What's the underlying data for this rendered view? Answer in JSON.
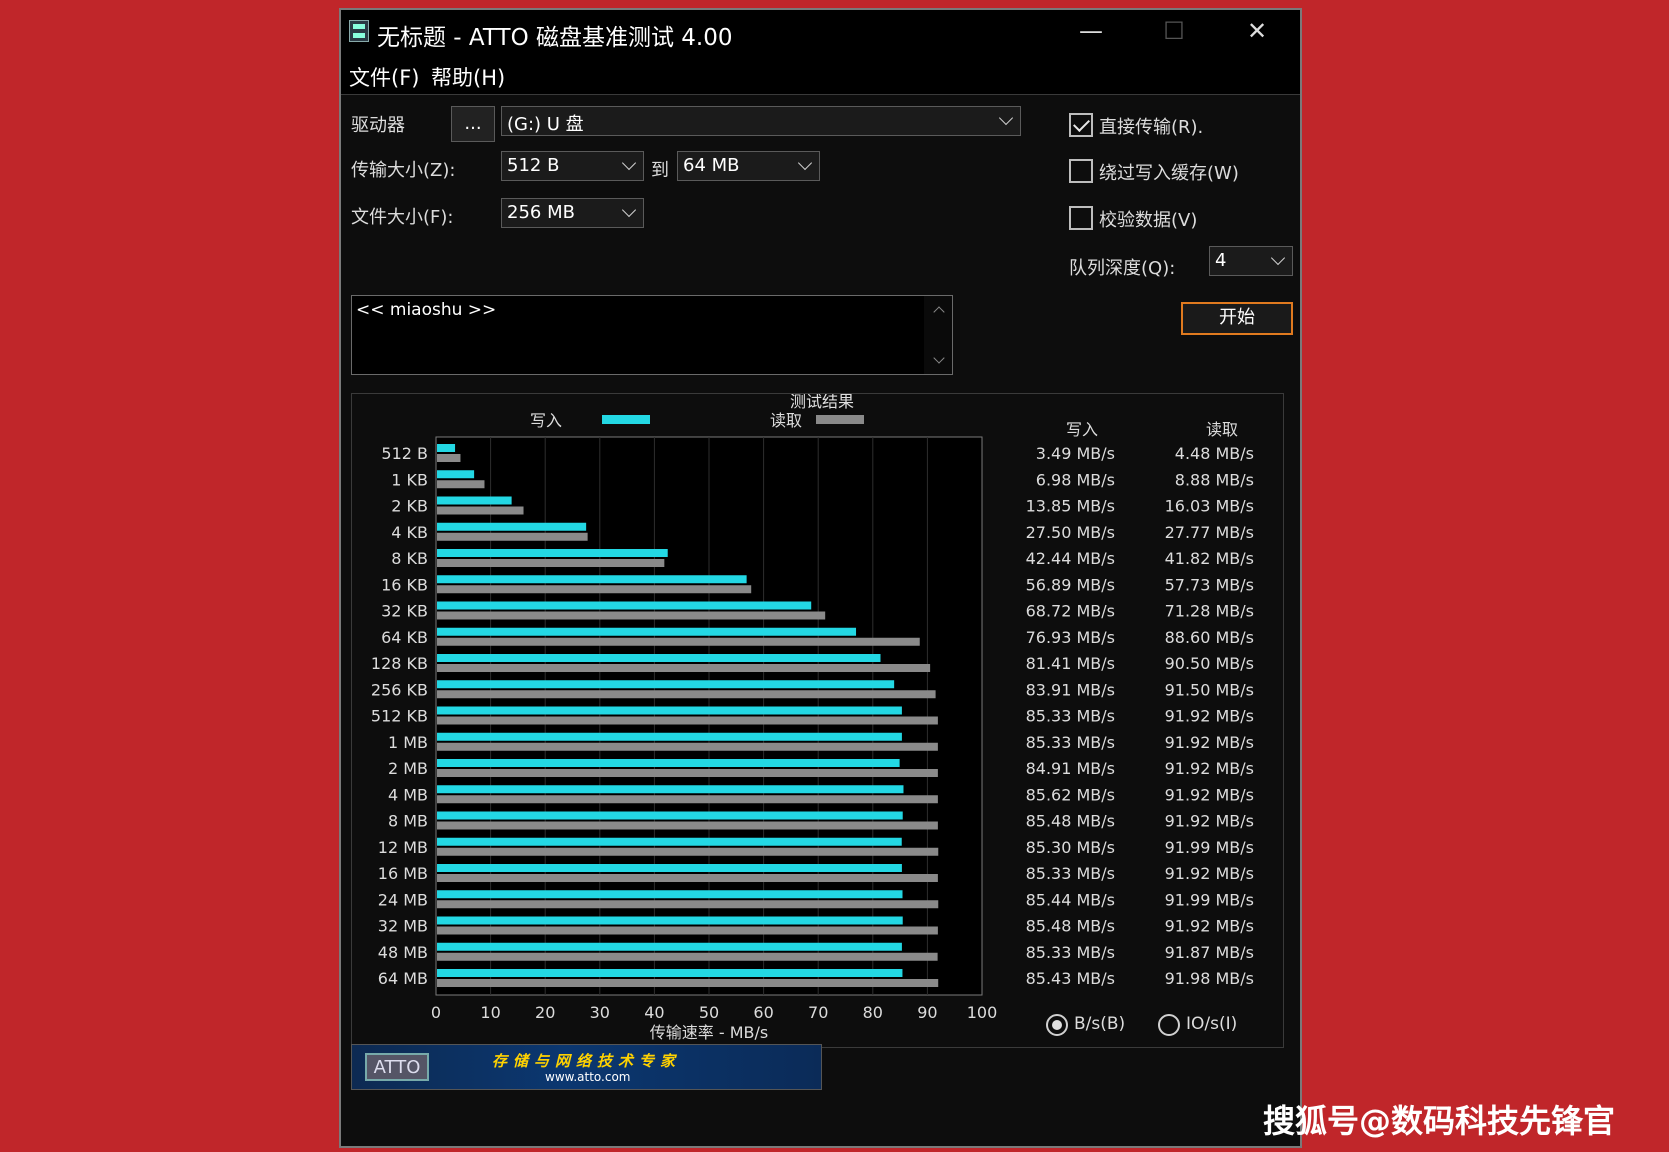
{
  "window": {
    "title": "无标题 - ATTO 磁盘基准测试 4.00",
    "minimize": "—",
    "maximize": "☐",
    "close": "✕"
  },
  "menu": {
    "file": "文件(F)",
    "help": "帮助(H)"
  },
  "settings": {
    "drive_label": "驱动器",
    "browse_button": "...",
    "drive_value": "(G:) U 盘",
    "transfer_label": "传输大小(Z):",
    "transfer_from": "512 B",
    "to_label": "到",
    "transfer_to": "64 MB",
    "file_size_label": "文件大小(F):",
    "file_size": "256 MB",
    "direct_io_label": "直接传输(R).",
    "direct_io_checked": true,
    "bypass_cache_label": "绕过写入缓存(W)",
    "bypass_cache_checked": false,
    "verify_label": "校验数据(V)",
    "verify_checked": false,
    "queue_label": "队列深度(Q):",
    "queue_depth": "4",
    "description": "<< miaoshu >>",
    "start_button": "开始"
  },
  "results": {
    "title": "测试结果",
    "legend_write": "写入",
    "legend_read": "读取",
    "col_write": "写入",
    "col_read": "读取",
    "radio_bps": "B/s(B)",
    "radio_iops": "IO/s(I)",
    "radio_selected": "B/s(B)"
  },
  "chart_data": {
    "type": "bar",
    "orientation": "horizontal",
    "xlabel": "传输速率 - MB/s",
    "xlim": [
      0,
      100
    ],
    "xticks": [
      "0",
      "10",
      "20",
      "30",
      "40",
      "50",
      "60",
      "70",
      "80",
      "90",
      "100"
    ],
    "grid": true,
    "legend": "top",
    "colors": {
      "write": "#23d8e4",
      "read": "#8a8a8a"
    },
    "categories": [
      "512 B",
      "1 KB",
      "2 KB",
      "4 KB",
      "8 KB",
      "16 KB",
      "32 KB",
      "64 KB",
      "128 KB",
      "256 KB",
      "512 KB",
      "1 MB",
      "2 MB",
      "4 MB",
      "8 MB",
      "12 MB",
      "16 MB",
      "24 MB",
      "32 MB",
      "48 MB",
      "64 MB"
    ],
    "series": [
      {
        "name": "写入",
        "values": [
          3.49,
          6.98,
          13.85,
          27.5,
          42.44,
          56.89,
          68.72,
          76.93,
          81.41,
          83.91,
          85.33,
          85.33,
          84.91,
          85.62,
          85.48,
          85.3,
          85.33,
          85.44,
          85.48,
          85.33,
          85.43
        ]
      },
      {
        "name": "读取",
        "values": [
          4.48,
          8.88,
          16.03,
          27.77,
          41.82,
          57.73,
          71.28,
          88.6,
          90.5,
          91.5,
          91.92,
          91.92,
          91.92,
          91.92,
          91.92,
          91.99,
          91.92,
          91.99,
          91.92,
          91.87,
          91.98
        ]
      }
    ],
    "write_labels": [
      "3.49 MB/s",
      "6.98 MB/s",
      "13.85 MB/s",
      "27.50 MB/s",
      "42.44 MB/s",
      "56.89 MB/s",
      "68.72 MB/s",
      "76.93 MB/s",
      "81.41 MB/s",
      "83.91 MB/s",
      "85.33 MB/s",
      "85.33 MB/s",
      "84.91 MB/s",
      "85.62 MB/s",
      "85.48 MB/s",
      "85.30 MB/s",
      "85.33 MB/s",
      "85.44 MB/s",
      "85.48 MB/s",
      "85.33 MB/s",
      "85.43 MB/s"
    ],
    "read_labels": [
      "4.48 MB/s",
      "8.88 MB/s",
      "16.03 MB/s",
      "27.77 MB/s",
      "41.82 MB/s",
      "57.73 MB/s",
      "71.28 MB/s",
      "88.60 MB/s",
      "90.50 MB/s",
      "91.50 MB/s",
      "91.92 MB/s",
      "91.92 MB/s",
      "91.92 MB/s",
      "91.92 MB/s",
      "91.92 MB/s",
      "91.99 MB/s",
      "91.92 MB/s",
      "91.99 MB/s",
      "91.92 MB/s",
      "91.87 MB/s",
      "91.98 MB/s"
    ]
  },
  "banner": {
    "logo": "ATTO",
    "slogan": "存储与网络技术专家",
    "url": "www.atto.com"
  },
  "watermark": "搜狐号@数码科技先锋官"
}
